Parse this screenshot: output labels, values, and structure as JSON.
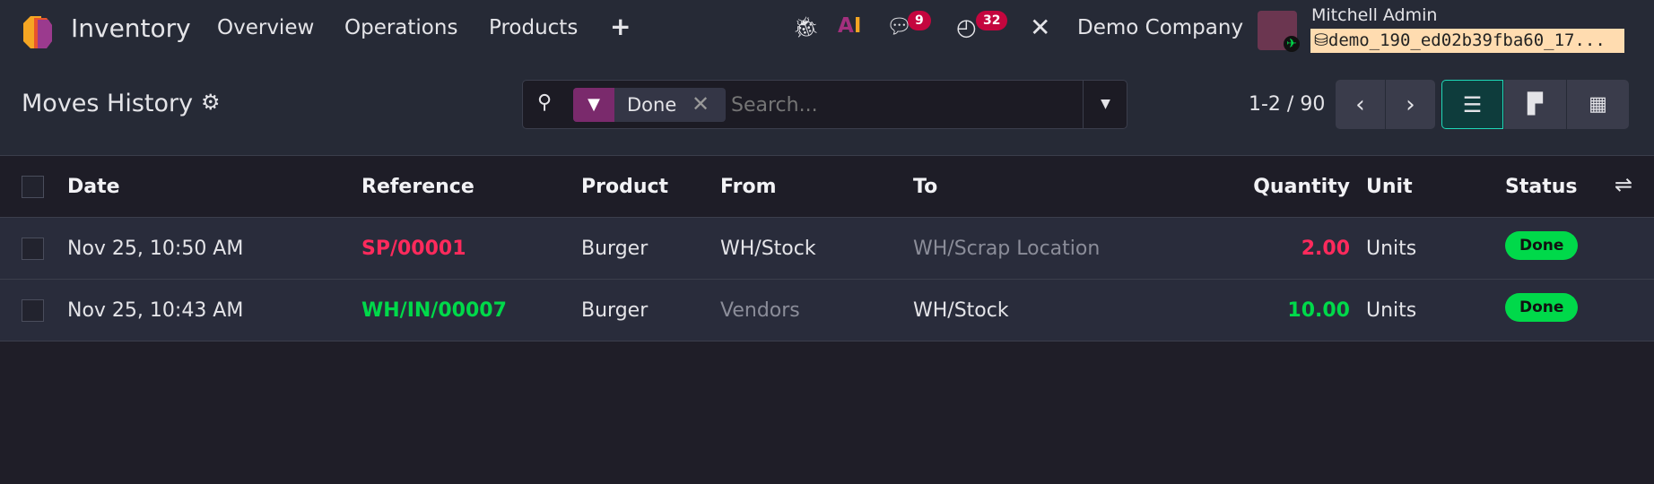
{
  "navbar": {
    "app_name": "Inventory",
    "menu": [
      "Overview",
      "Operations",
      "Products"
    ],
    "add_icon": "plus-icon",
    "chat_count": "9",
    "activity_count": "32",
    "company": "Demo Company",
    "user": "Mitchell Admin",
    "database": "demo_190_ed02b39fba60_17..."
  },
  "control": {
    "title": "Moves History",
    "facet": "Done",
    "search_placeholder": "Search...",
    "pager": "1-2 / 90"
  },
  "table": {
    "columns": [
      "Date",
      "Reference",
      "Product",
      "From",
      "To",
      "Quantity",
      "Unit",
      "Status"
    ],
    "rows": [
      {
        "date": "Nov 25, 10:50 AM",
        "reference": "SP/00001",
        "product": "Burger",
        "from": "WH/Stock",
        "to": "WH/Scrap Location",
        "quantity": "2.00",
        "unit": "Units",
        "status": "Done"
      },
      {
        "date": "Nov 25, 10:43 AM",
        "reference": "WH/IN/00007",
        "product": "Burger",
        "from": "Vendors",
        "to": "WH/Stock",
        "quantity": "10.00",
        "unit": "Units",
        "status": "Done"
      }
    ]
  },
  "colors": {
    "out": "#ff2a5c",
    "in": "#00d94a",
    "done": "#00d94a",
    "filter": "#7a2a6c",
    "active_view": "#0e3c3c"
  }
}
